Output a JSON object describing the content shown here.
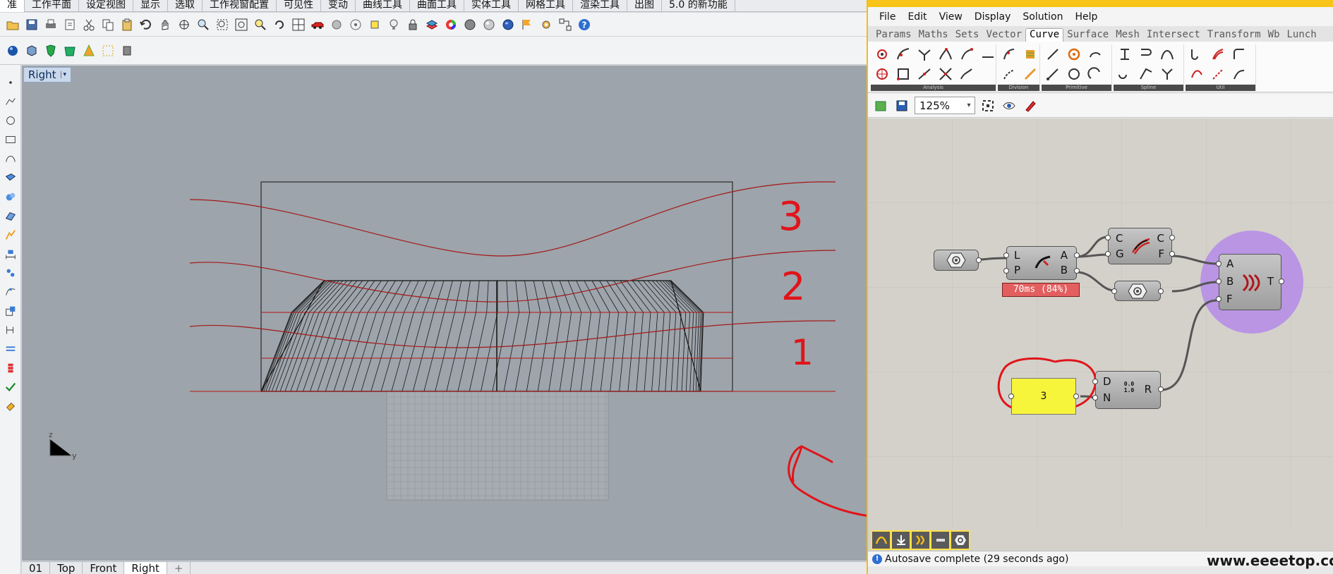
{
  "rhino": {
    "menu_tabs": [
      "准",
      "工作平面",
      "设定视图",
      "显示",
      "选取",
      "工作视窗配置",
      "可见性",
      "变动",
      "曲线工具",
      "曲面工具",
      "实体工具",
      "网格工具",
      "渲染工具",
      "出图",
      "5.0 的新功能"
    ],
    "viewport_title": "Right",
    "viewport_tabs": [
      "01",
      "Top",
      "Front",
      "Right",
      "+"
    ],
    "axis_z": "z",
    "axis_y": "y",
    "annotations": [
      "3",
      "2",
      "1"
    ]
  },
  "grasshopper": {
    "menu": [
      "File",
      "Edit",
      "View",
      "Display",
      "Solution",
      "Help"
    ],
    "tabs": [
      "Params",
      "Maths",
      "Sets",
      "Vector",
      "Curve",
      "Surface",
      "Mesh",
      "Intersect",
      "Transform",
      "Wb",
      "Lunch"
    ],
    "active_tab": "Curve",
    "ribbon_groups": [
      "Analysis",
      "Division",
      "Primitive",
      "Spline",
      "Util"
    ],
    "zoom": "125%",
    "components": {
      "divide": {
        "in": [
          "L",
          "P"
        ],
        "out": [
          "A",
          "B"
        ],
        "profiler": "70ms (84%)"
      },
      "offset": {
        "in": [
          "C",
          "G"
        ],
        "out": [
          "C",
          "F"
        ]
      },
      "tween": {
        "in": [
          "A",
          "B",
          "F"
        ],
        "out": [
          "T"
        ]
      },
      "range": {
        "in": [
          "D",
          "N"
        ],
        "out": [
          "R"
        ],
        "icon_label": "0.0\n1.0"
      },
      "slider_value": "3"
    },
    "status": "Autosave complete (29 seconds ago)"
  },
  "watermark": "www.eeeetop.com",
  "colors": {
    "accent": "#f7c417",
    "red_annotation": "#e0141a",
    "viewport_bg": "#9da4ab",
    "profiler_bg": "#e35f5f",
    "slider_bg": "#f7f43c",
    "tween_halo": "#b48be9"
  }
}
